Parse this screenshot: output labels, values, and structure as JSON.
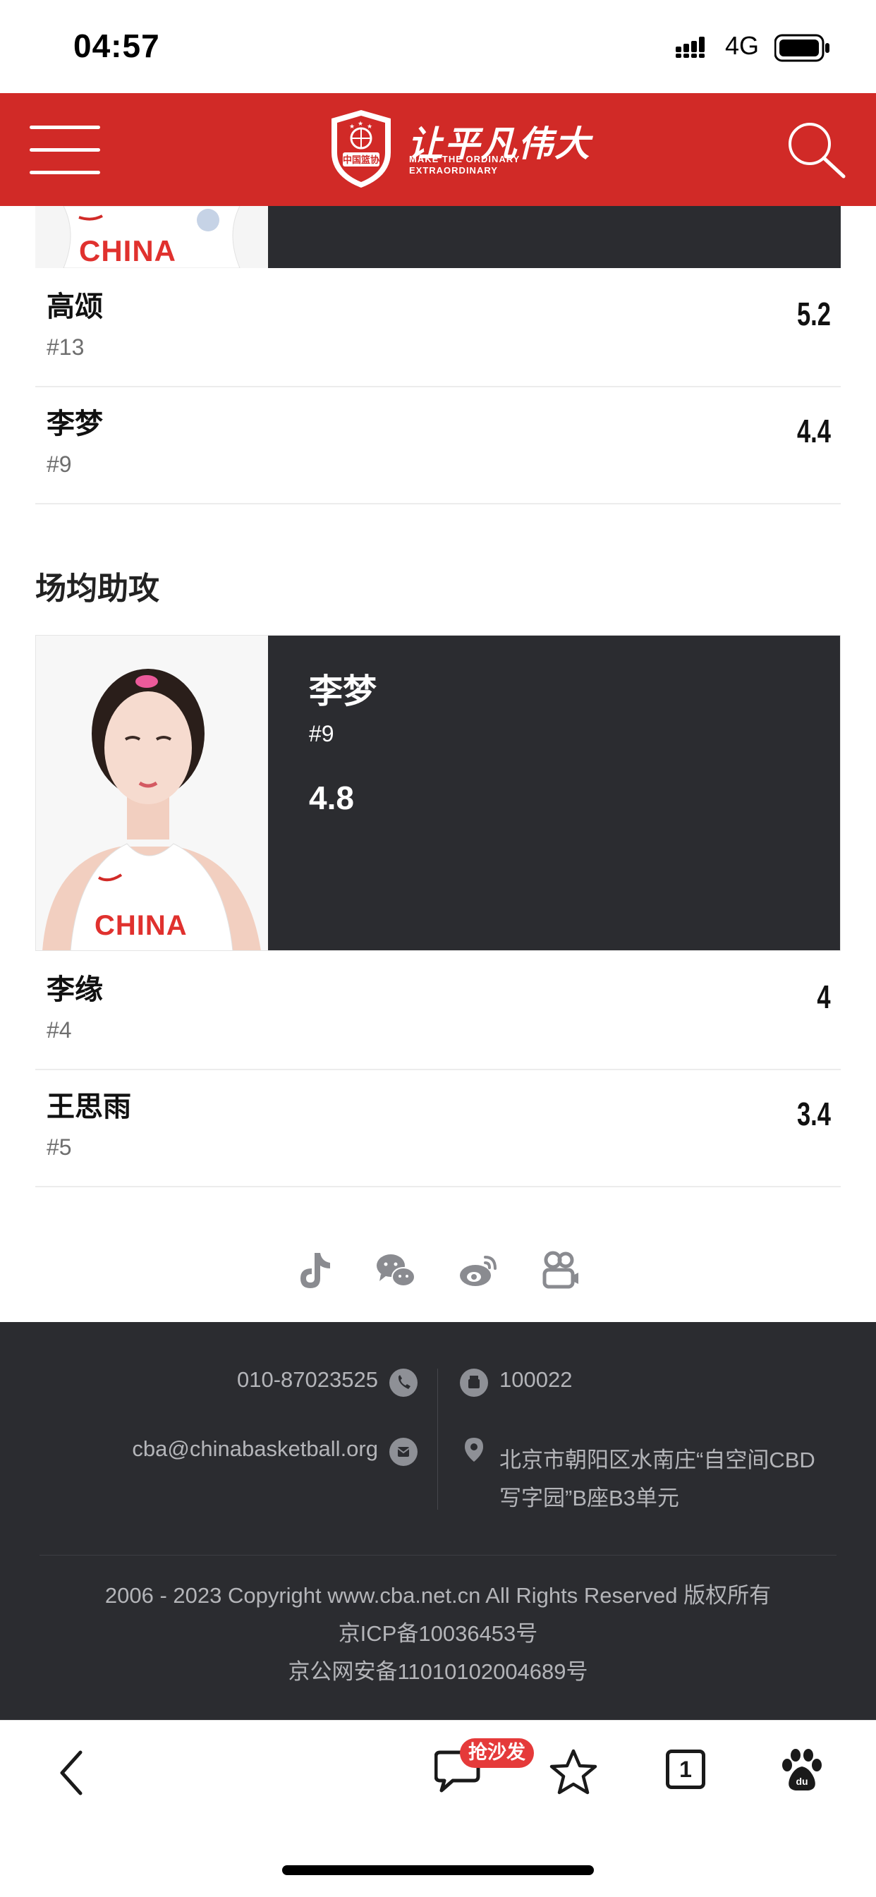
{
  "status_bar": {
    "time": "04:57",
    "network": "4G"
  },
  "header": {
    "logo_text": "中国篮协",
    "slogan_cn": "让平凡伟大",
    "slogan_en_line1": "MAKE THE ORDINARY",
    "slogan_en_line2": "EXTRAORDINARY"
  },
  "partial_card": {
    "jersey_text": "CHINA"
  },
  "prev_section_rows": [
    {
      "name": "高颂",
      "number": "#13",
      "value": "5.2"
    },
    {
      "name": "李梦",
      "number": "#9",
      "value": "4.4"
    }
  ],
  "assists_section": {
    "title": "场均助攻",
    "featured": {
      "name": "李梦",
      "number": "#9",
      "value": "4.8",
      "jersey_text": "CHINA"
    },
    "rows": [
      {
        "name": "李缘",
        "number": "#4",
        "value": "4"
      },
      {
        "name": "王思雨",
        "number": "#5",
        "value": "3.4"
      }
    ]
  },
  "social_icons": [
    "douyin-icon",
    "wechat-icon",
    "weibo-icon",
    "video-icon"
  ],
  "footer": {
    "phone": "010-87023525",
    "email": "cba@chinabasketball.org",
    "postcode": "100022",
    "address_line1": "北京市朝阳区水南庄“自空间CBD",
    "address_line2": "写字园”B座B3单元",
    "copyright": "2006 - 2023 Copyright www.cba.net.cn All Rights Reserved 版权所有",
    "icp": "京ICP备10036453号",
    "police": "京公网安备11010102004689号"
  },
  "bottom_bar": {
    "comment_badge": "抢沙发",
    "tab_count": "1"
  },
  "colors": {
    "brand_red": "#d12a27",
    "dark_panel": "#2b2c30",
    "footer_text": "#b4b5b9"
  }
}
